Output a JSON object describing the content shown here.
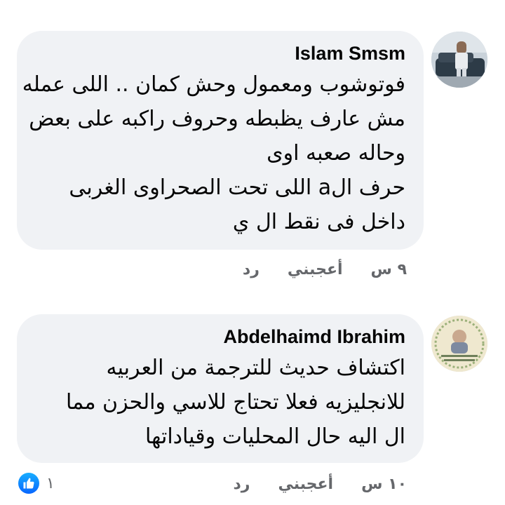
{
  "comments": [
    {
      "author": "Islam Smsm",
      "lines": [
        "فوتوشوب ومعمول وحش كمان .. اللى عمله",
        "مش عارف يظبطه وحروف راكبه على بعض",
        "وحاله صعبه اوى",
        "حرف الa اللى تحت الصحراوى الغربى",
        "داخل فى نقط ال ي"
      ],
      "time": "٩ س",
      "like_label": "أعجبني",
      "reply_label": "رد"
    },
    {
      "author": "Abdelhaimd Ibrahim",
      "lines": [
        "اكتشاف حديث للترجمة من العربيه",
        "للانجليزيه فعلا تحتاج للاسي والحزن مما",
        "ال اليه حال المحليات وقياداتها"
      ],
      "time": "١٠ س",
      "like_label": "أعجبني",
      "reply_label": "رد",
      "reaction_count": "١",
      "reaction_icon": "like-icon"
    }
  ]
}
